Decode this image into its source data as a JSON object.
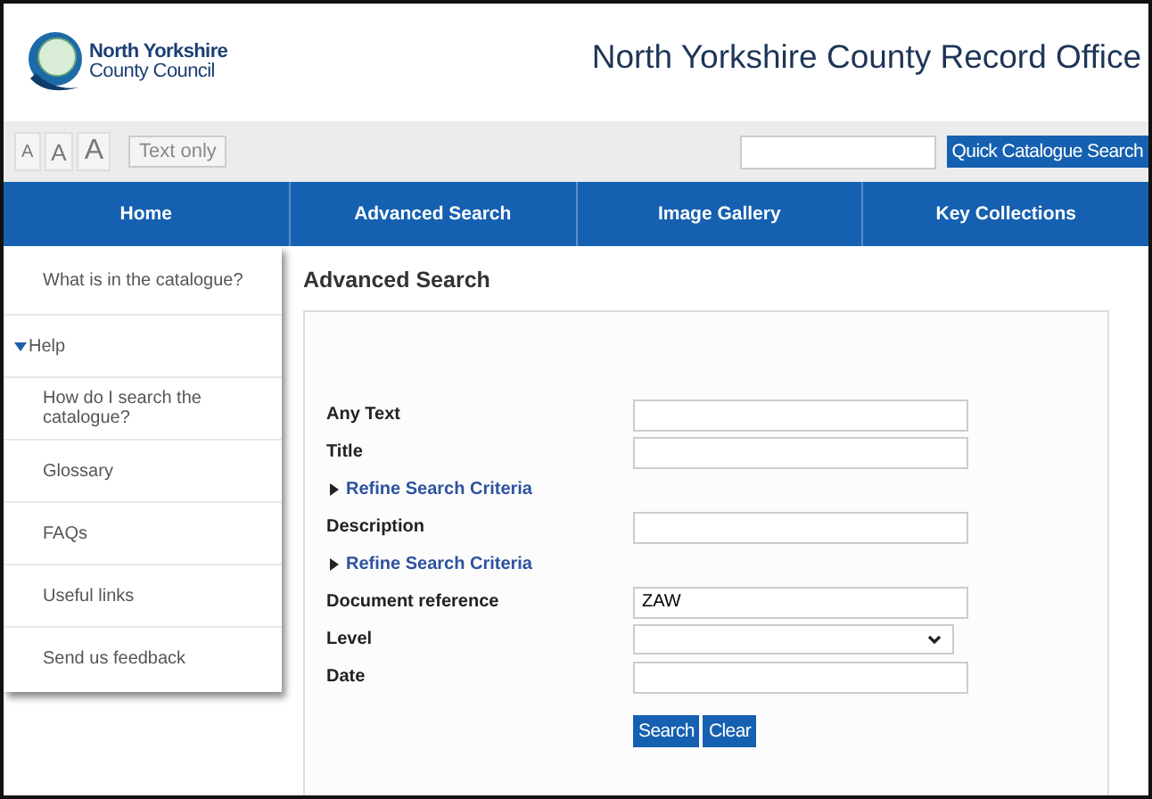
{
  "header": {
    "org_line1": "North Yorkshire",
    "org_line2": "County Council",
    "site_title": "North Yorkshire County Record Office"
  },
  "toolbar": {
    "text_size_buttons": [
      "A",
      "A",
      "A"
    ],
    "text_only": "Text only",
    "quick_search_button": "Quick Catalogue Search"
  },
  "nav": [
    {
      "label": "Home",
      "selected": false
    },
    {
      "label": "Advanced Search",
      "selected": false
    },
    {
      "label": "Image Gallery",
      "selected": false
    },
    {
      "label": "Key Collections",
      "selected": false
    }
  ],
  "menu": [
    {
      "label": "What is in the catalogue?"
    },
    {
      "label": "Help",
      "expanded": true,
      "children": [
        {
          "label": "How do I search the catalogue?"
        },
        {
          "label": "Glossary"
        },
        {
          "label": "FAQs"
        },
        {
          "label": "Useful links"
        },
        {
          "label": "Send us feedback"
        }
      ]
    }
  ],
  "page_title": "Advanced Search",
  "form": [
    {
      "kind": "field",
      "label": "Any Text"
    },
    {
      "kind": "field",
      "label": "Title"
    },
    {
      "kind": "link",
      "label": "Refine Search Criteria"
    },
    {
      "kind": "field",
      "label": "Description"
    },
    {
      "kind": "link",
      "label": "Refine Search Criteria"
    },
    {
      "kind": "field",
      "label": "Document reference",
      "value": "ZAW"
    },
    {
      "kind": "select",
      "label": "Level"
    },
    {
      "kind": "field",
      "label": "Date"
    }
  ],
  "buttons": [
    "Search",
    "Clear"
  ]
}
